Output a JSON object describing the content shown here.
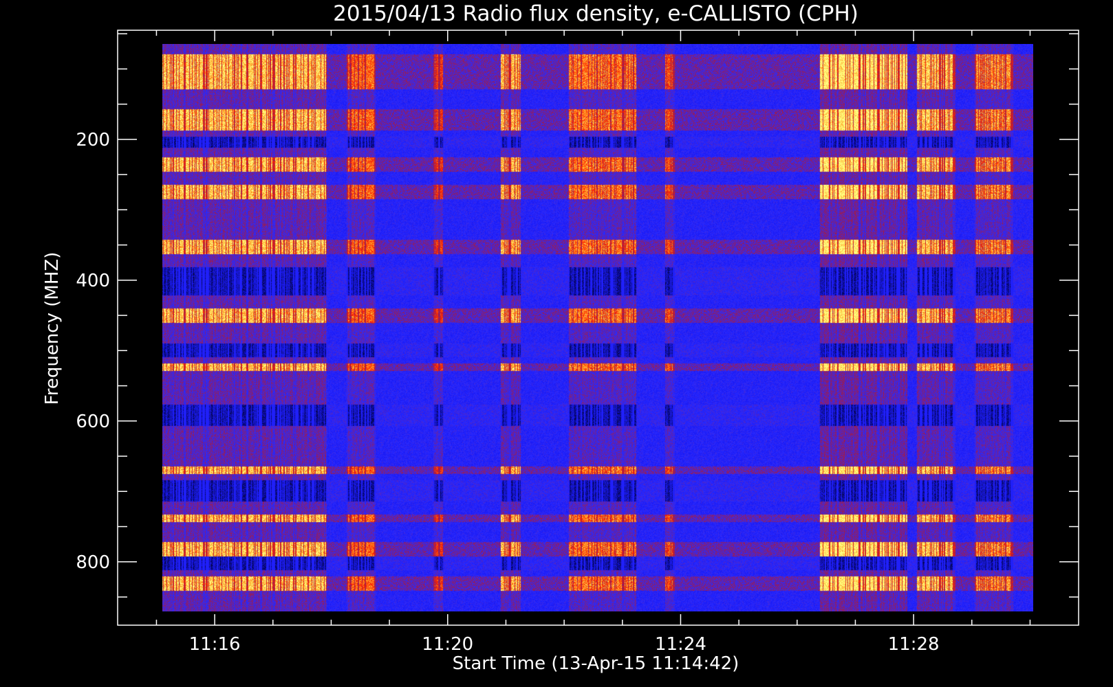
{
  "chart_data": {
    "type": "heatmap",
    "title": "2015/04/13  Radio flux density, e-CALLISTO (CPH)",
    "xlabel": "Start Time (13-Apr-15 11:14:42)",
    "ylabel": "Frequency (MHZ)",
    "x_range_minutes": [
      "11:14:20",
      "11:30:50"
    ],
    "data_time_range": [
      "11:15:00",
      "11:30:00"
    ],
    "ylim": [
      45,
      890
    ],
    "data_freq_range": [
      45,
      870
    ],
    "y_reversed": true,
    "x_ticks": [
      {
        "value": "11:16",
        "minute": 16
      },
      {
        "value": "11:20",
        "minute": 20
      },
      {
        "value": "11:24",
        "minute": 24
      },
      {
        "value": "11:28",
        "minute": 28
      }
    ],
    "y_ticks": [
      {
        "value": "200",
        "mhz": 200
      },
      {
        "value": "400",
        "mhz": 400
      },
      {
        "value": "600",
        "mhz": 600
      },
      {
        "value": "800",
        "mhz": 800
      }
    ],
    "colormap": [
      "#000000",
      "#1414f0",
      "#2a2aff",
      "#a01c4a",
      "#ff2000",
      "#ff9a20",
      "#ffff80"
    ],
    "strong_bands_mhz": [
      [
        60,
        110
      ],
      [
        140,
        170
      ],
      [
        210,
        230
      ],
      [
        250,
        270
      ],
      [
        330,
        350
      ],
      [
        430,
        450
      ],
      [
        510,
        520
      ],
      [
        660,
        670
      ],
      [
        730,
        740
      ],
      [
        770,
        790
      ],
      [
        820,
        840
      ]
    ],
    "quiet_bands_mhz": [
      [
        180,
        195
      ],
      [
        370,
        410
      ],
      [
        480,
        500
      ],
      [
        570,
        600
      ],
      [
        680,
        710
      ],
      [
        790,
        810
      ]
    ],
    "burst_intervals": [
      {
        "start": "11:15:00",
        "end": "11:17:50",
        "level": 0.9
      },
      {
        "start": "11:18:10",
        "end": "11:18:40",
        "level": 0.65
      },
      {
        "start": "11:19:40",
        "end": "11:19:50",
        "level": 0.5
      },
      {
        "start": "11:20:50",
        "end": "11:21:10",
        "level": 0.85
      },
      {
        "start": "11:22:00",
        "end": "11:23:10",
        "level": 0.7
      },
      {
        "start": "11:23:40",
        "end": "11:23:50",
        "level": 0.6
      },
      {
        "start": "11:26:20",
        "end": "11:27:50",
        "level": 1.0
      },
      {
        "start": "11:28:00",
        "end": "11:28:40",
        "level": 0.9
      },
      {
        "start": "11:29:00",
        "end": "11:29:40",
        "level": 0.75
      }
    ],
    "grid": false,
    "legend": "none",
    "background": "#000000",
    "axis_color": "#ffffff"
  }
}
